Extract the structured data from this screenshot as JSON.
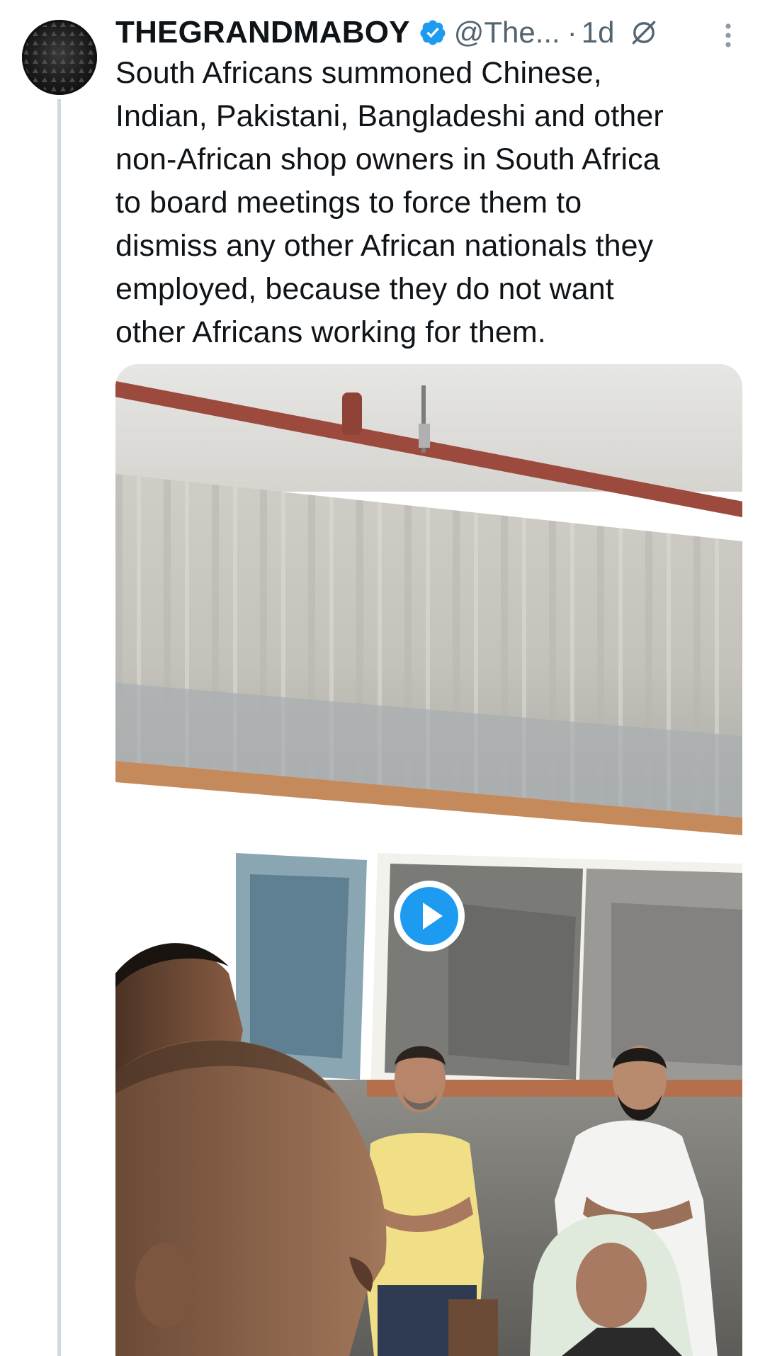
{
  "tweet": {
    "author": {
      "display_name": "THEGRANDMABOY",
      "handle": "@The...",
      "verified": true,
      "avatar_icon": "avatar-image"
    },
    "separator": "·",
    "timestamp": "1d",
    "edited_icon": "edit-history-icon",
    "more_icon": "more-vertical-icon",
    "text": "South Africans summoned Chinese,\nIndian, Pakistani, Bangladeshi and other\nnon-African shop owners in South Africa\nto board meetings to force them to\ndismiss any other African nationals they\nemployed, because they do not want\nother Africans working for them.",
    "media": {
      "type": "video",
      "play_icon": "play-icon"
    }
  },
  "colors": {
    "text_primary": "#0f1419",
    "text_secondary": "#536471",
    "verified_blue": "#1d9bf0",
    "thread_line": "#cfd9de"
  }
}
